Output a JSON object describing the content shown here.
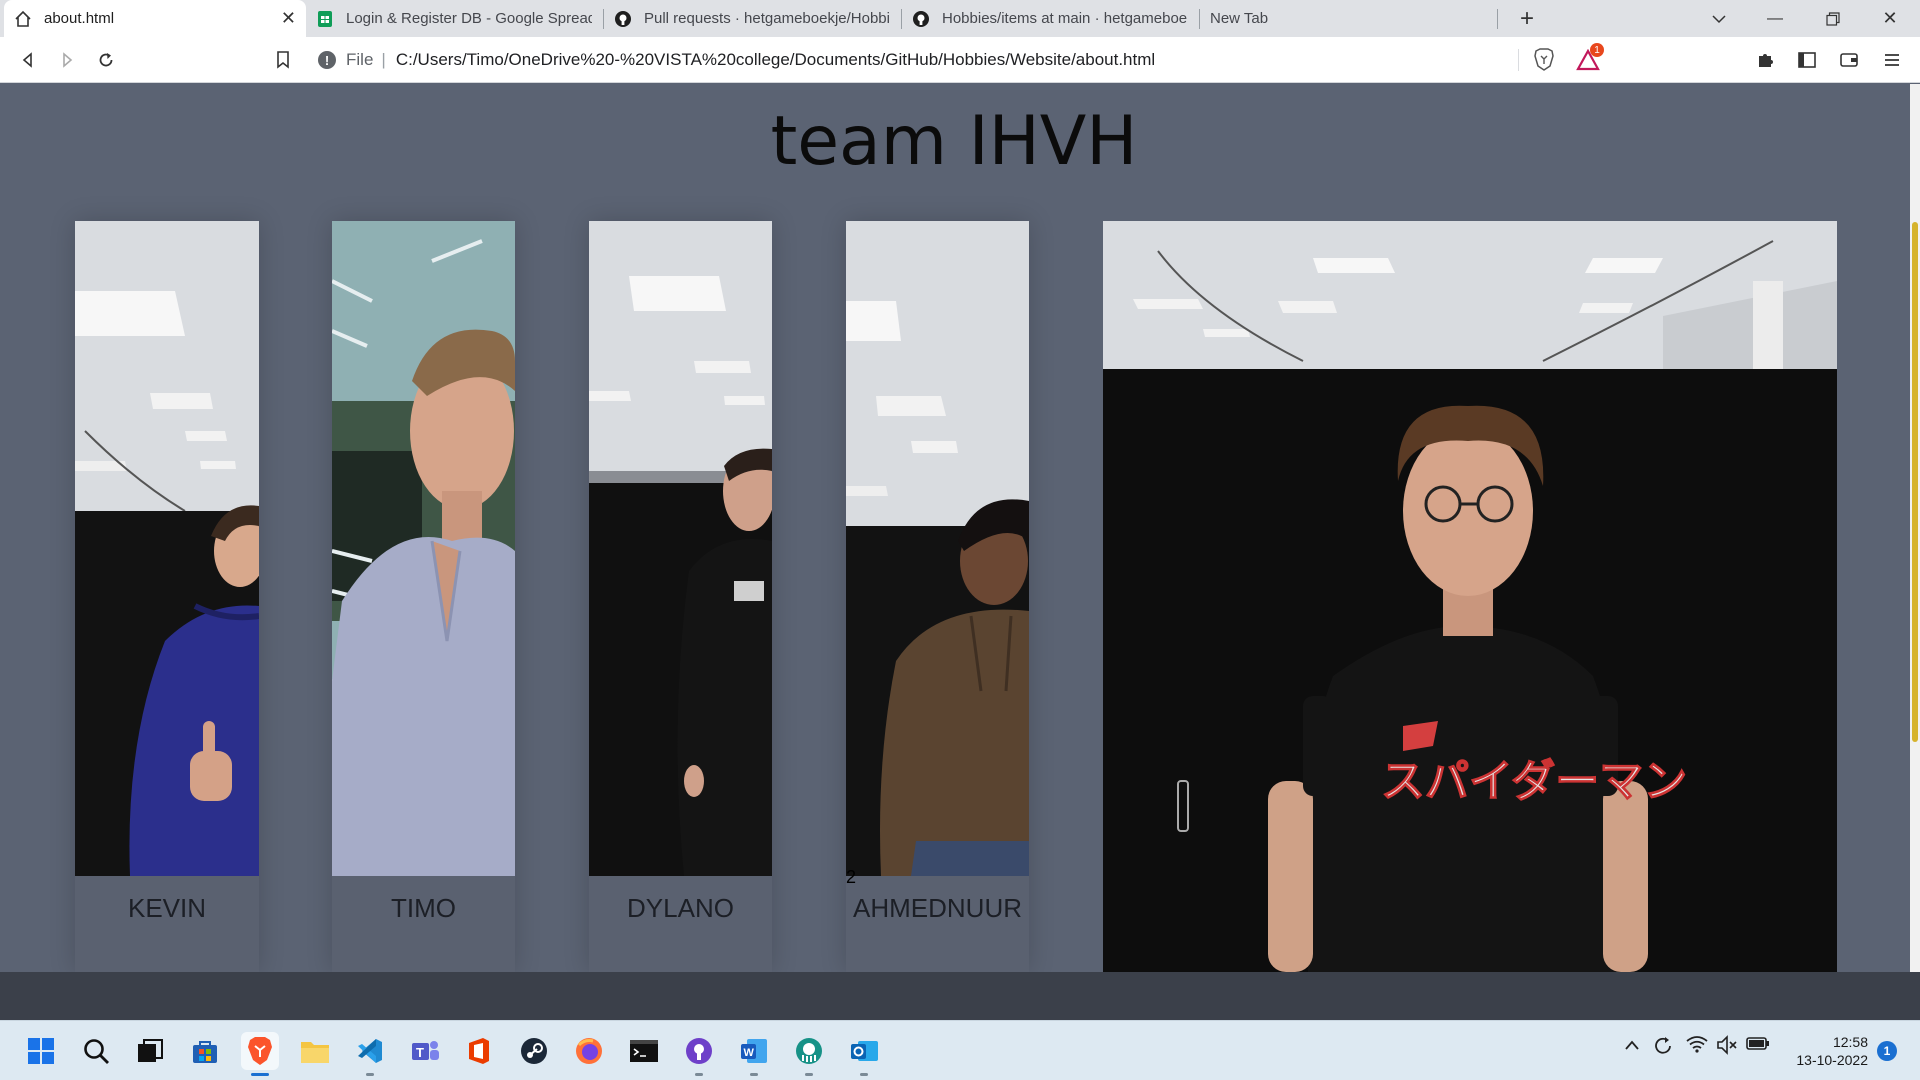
{
  "browser": {
    "tabs": [
      {
        "label": "about.html",
        "icon": "home-icon",
        "active": true
      },
      {
        "label": "Login & Register DB - Google Spreadsheets",
        "icon": "google-sheets-icon",
        "active": false
      },
      {
        "label": "Pull requests · hetgameboekje/Hobbies",
        "icon": "github-icon",
        "active": false
      },
      {
        "label": "Hobbies/items at main · hetgameboekje/Hobbies",
        "icon": "github-icon",
        "active": false
      },
      {
        "label": "New Tab",
        "icon": "",
        "active": false
      }
    ],
    "address": {
      "scheme": "File",
      "url": "C:/Users/Timo/OneDrive%20-%20VISTA%20college/Documents/GitHub/Hobbies/Website/about.html"
    },
    "brave_rewards_badge": "1"
  },
  "page": {
    "title": "team IHVH",
    "members": [
      {
        "name": "KEVIN",
        "shirt": "#2b2f8c",
        "wall": "#121212"
      },
      {
        "name": "TIMO",
        "shirt": "#a6acc8",
        "wall": "#3c4a45"
      },
      {
        "name": "DYLANO",
        "shirt": "#141414",
        "wall": "#101010"
      },
      {
        "name": "AHMEDNUUR",
        "shirt": "#5a4430",
        "wall": "#121212"
      }
    ],
    "stray_text": "2",
    "featured_photo_shirt_text": "スパイダーマン"
  },
  "taskbar": {
    "icons": [
      {
        "name": "start-icon"
      },
      {
        "name": "search-icon"
      },
      {
        "name": "task-view-icon"
      },
      {
        "name": "store-icon"
      },
      {
        "name": "brave-icon",
        "active": true
      },
      {
        "name": "file-explorer-icon"
      },
      {
        "name": "vscode-icon"
      },
      {
        "name": "teams-icon"
      },
      {
        "name": "office-icon"
      },
      {
        "name": "steam-icon"
      },
      {
        "name": "firefox-icon"
      },
      {
        "name": "terminal-icon"
      },
      {
        "name": "github-desktop-icon"
      },
      {
        "name": "word-icon"
      },
      {
        "name": "gitkraken-icon"
      },
      {
        "name": "outlook-icon"
      }
    ],
    "time": "12:58",
    "date": "13-10-2022",
    "notifications": "1"
  }
}
